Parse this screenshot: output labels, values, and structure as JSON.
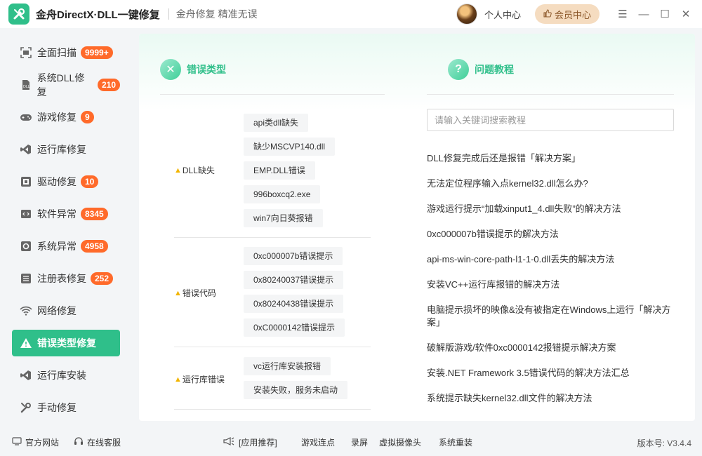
{
  "header": {
    "app_title": "金舟DirectX·DLL一键修复",
    "slogan": "金舟修复 精准无误",
    "personal_center": "个人中心",
    "vip_center": "会员中心"
  },
  "sidebar": {
    "items": [
      {
        "label": "全面扫描",
        "badge": "9999+",
        "icon": "scan-icon"
      },
      {
        "label": "系统DLL修复",
        "badge": "210",
        "icon": "dll-icon"
      },
      {
        "label": "游戏修复",
        "badge": "9",
        "icon": "gamepad-icon"
      },
      {
        "label": "运行库修复",
        "badge": "",
        "icon": "vs-icon"
      },
      {
        "label": "驱动修复",
        "badge": "10",
        "icon": "driver-icon"
      },
      {
        "label": "软件异常",
        "badge": "8345",
        "icon": "code-icon"
      },
      {
        "label": "系统异常",
        "badge": "4958",
        "icon": "gear-icon"
      },
      {
        "label": "注册表修复",
        "badge": "252",
        "icon": "registry-icon"
      },
      {
        "label": "网络修复",
        "badge": "",
        "icon": "wifi-icon"
      },
      {
        "label": "错误类型修复",
        "badge": "",
        "icon": "warning-icon"
      },
      {
        "label": "运行库安装",
        "badge": "",
        "icon": "vs-icon"
      },
      {
        "label": "手动修复",
        "badge": "",
        "icon": "wrench-icon"
      }
    ]
  },
  "errors": {
    "title": "错误类型",
    "groups": [
      {
        "label": "DLL缺失",
        "tags": [
          "api类dll缺失",
          "缺少MSCVP140.dll",
          "EMP.DLL错误",
          "996boxcq2.exe",
          "win7向日葵报错"
        ]
      },
      {
        "label": "错误代码",
        "tags": [
          "0xc000007b错误提示",
          "0x80240037错误提示",
          "0x80240438错误提示",
          "0xC0000142错误提示"
        ]
      },
      {
        "label": "运行库错误",
        "tags": [
          "vc运行库安装报错",
          "安装失败，服务未启动"
        ]
      }
    ]
  },
  "tutorials": {
    "title": "问题教程",
    "search_placeholder": "请输入关键词搜索教程",
    "links": [
      "DLL修复完成后还是报错「解决方案」",
      "无法定位程序输入点kernel32.dll怎么办?",
      "游戏运行提示“加载xinput1_4.dll失败”的解决方法",
      "0xc000007b错误提示的解决方法",
      "api-ms-win-core-path-l1-1-0.dll丢失的解决方法",
      "安装VC++运行库报错的解决方法",
      "电脑提示损坏的映像&没有被指定在Windows上运行「解决方案」",
      "破解版游戏/软件0xc0000142报错提示解决方案",
      "安装.NET Framework 3.5错误代码的解决方法汇总",
      "系统提示缺失kernel32.dll文件的解决方法"
    ]
  },
  "footer": {
    "official_site": "官方网站",
    "online_service": "在线客服",
    "recommend": "[应用推荐]",
    "links": [
      "游戏连点",
      "录屏",
      "虚拟摄像头",
      "系统重装"
    ],
    "version": "版本号: V3.4.4"
  },
  "colors": {
    "accent": "#2fbf8a",
    "badge": "#ff6a2a",
    "vip_bg": "#f5dcc0"
  }
}
